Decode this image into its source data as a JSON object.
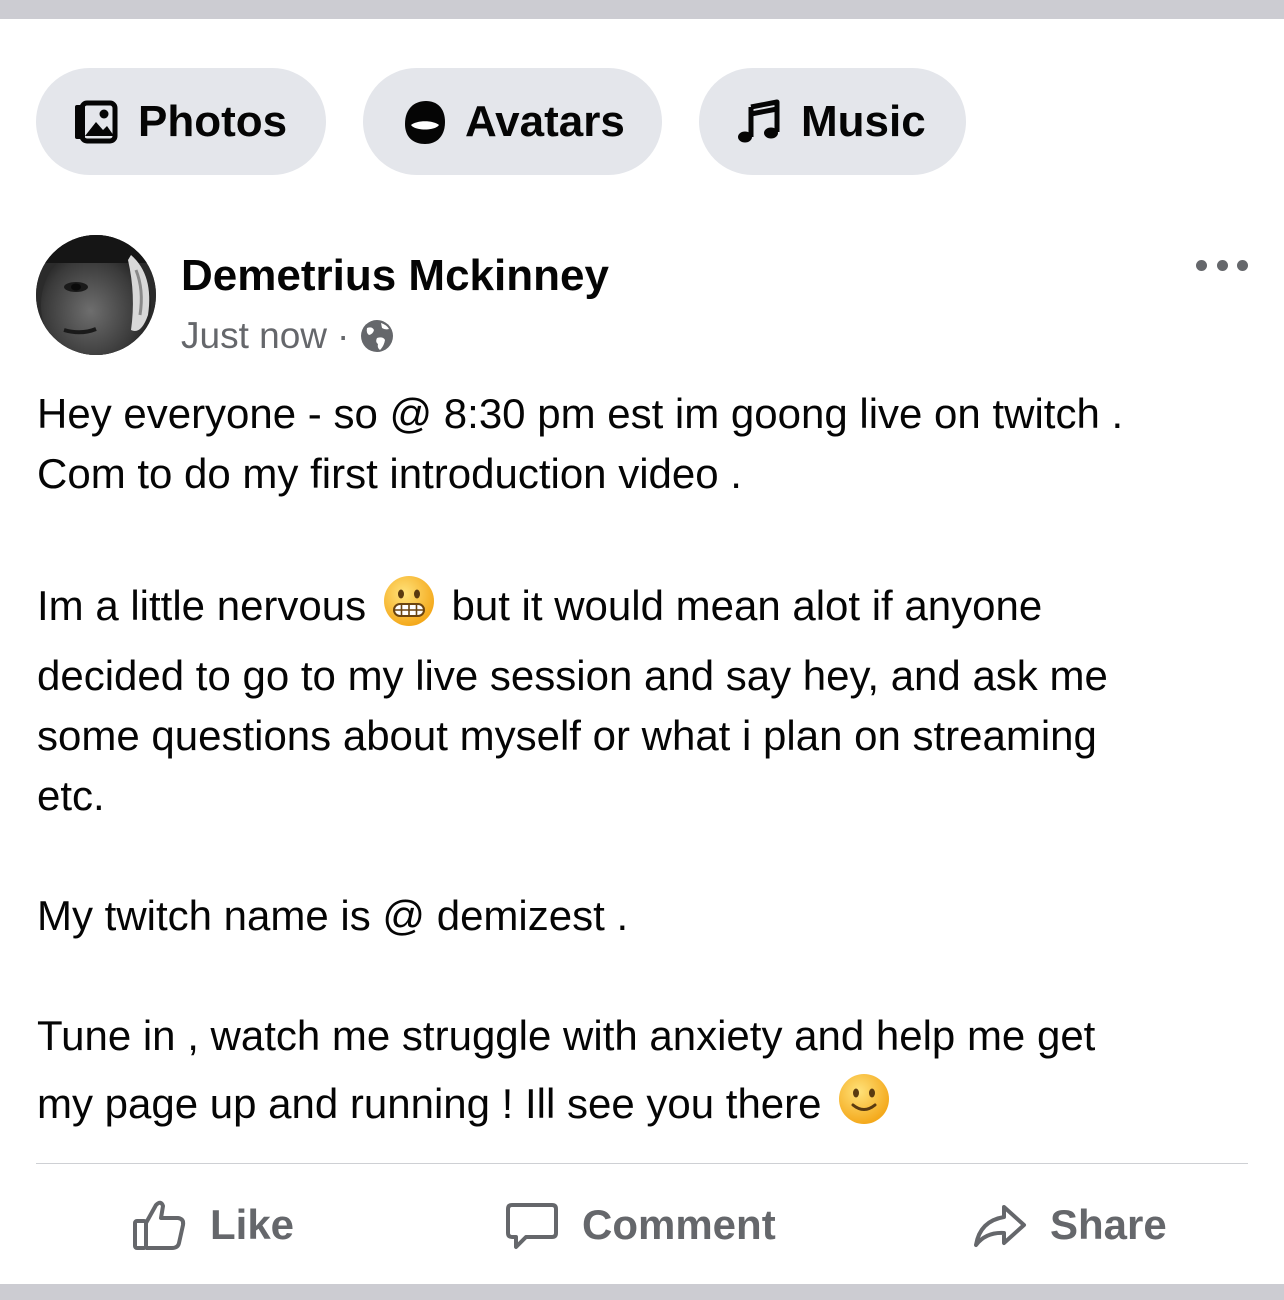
{
  "chips": {
    "photos": {
      "label": "Photos",
      "icon": "photos-icon"
    },
    "avatars": {
      "label": "Avatars",
      "icon": "avatar-icon"
    },
    "music": {
      "label": "Music",
      "icon": "music-note-icon"
    }
  },
  "post": {
    "author": "Demetrius Mckinney",
    "timestamp": "Just now",
    "separator": "·",
    "audience_icon": "globe-icon",
    "lines": {
      "l1": "Hey everyone - so @ 8:30 pm est im goong live on twitch .",
      "l2": "Com to do my first introduction video .",
      "l3a": "Im a little nervous",
      "l3b": "but it would mean alot if anyone",
      "l4": "decided to go to my live session and say hey, and ask me",
      "l5": "some questions about myself or what i plan on streaming",
      "l6": "etc.",
      "l7": "My twitch name is @ demizest .",
      "l8": "Tune in , watch me struggle with anxiety and help me get",
      "l9": "my page up and running ! Ill see you there"
    },
    "emojis": {
      "grimace": "grimacing-face-emoji",
      "smile": "slightly-smiling-face-emoji"
    }
  },
  "actions": {
    "like": "Like",
    "comment": "Comment",
    "share": "Share"
  },
  "colors": {
    "chip_bg": "#e4e6eb",
    "secondary_text": "#65676b",
    "divider": "#ced0d4",
    "primary_text": "#050505"
  }
}
